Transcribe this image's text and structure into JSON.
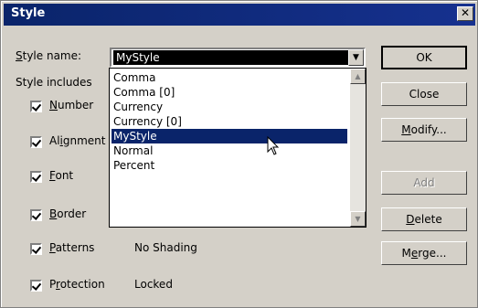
{
  "dialog": {
    "title": "Style",
    "close_glyph": "✕"
  },
  "style_name": {
    "label": "Style name:",
    "value": "MyStyle"
  },
  "style_includes": {
    "label": "Style includes"
  },
  "checkboxes": [
    {
      "label": "Number",
      "checked": true,
      "value": ""
    },
    {
      "label": "Alignment",
      "checked": true,
      "value": ""
    },
    {
      "label": "Font",
      "checked": true,
      "value": ""
    },
    {
      "label": "Border",
      "checked": true,
      "value": ""
    },
    {
      "label": "Patterns",
      "checked": true,
      "value": "No Shading"
    },
    {
      "label": "Protection",
      "checked": true,
      "value": "Locked"
    }
  ],
  "dropdown": {
    "options": [
      "Comma",
      "Comma [0]",
      "Currency",
      "Currency [0]",
      "MyStyle",
      "Normal",
      "Percent"
    ],
    "selected": "MyStyle"
  },
  "buttons": {
    "ok": "OK",
    "close": "Close",
    "modify": "Modify...",
    "add": "Add",
    "delete": "Delete",
    "merge": "Merge..."
  },
  "colors": {
    "title_bar": "#0a246a",
    "selection": "#0a246a",
    "face": "#d4d0c8"
  },
  "icons": {
    "close": "close-icon",
    "dropdown_arrow": "chevron-down-icon",
    "cursor": "mouse-pointer-icon"
  }
}
